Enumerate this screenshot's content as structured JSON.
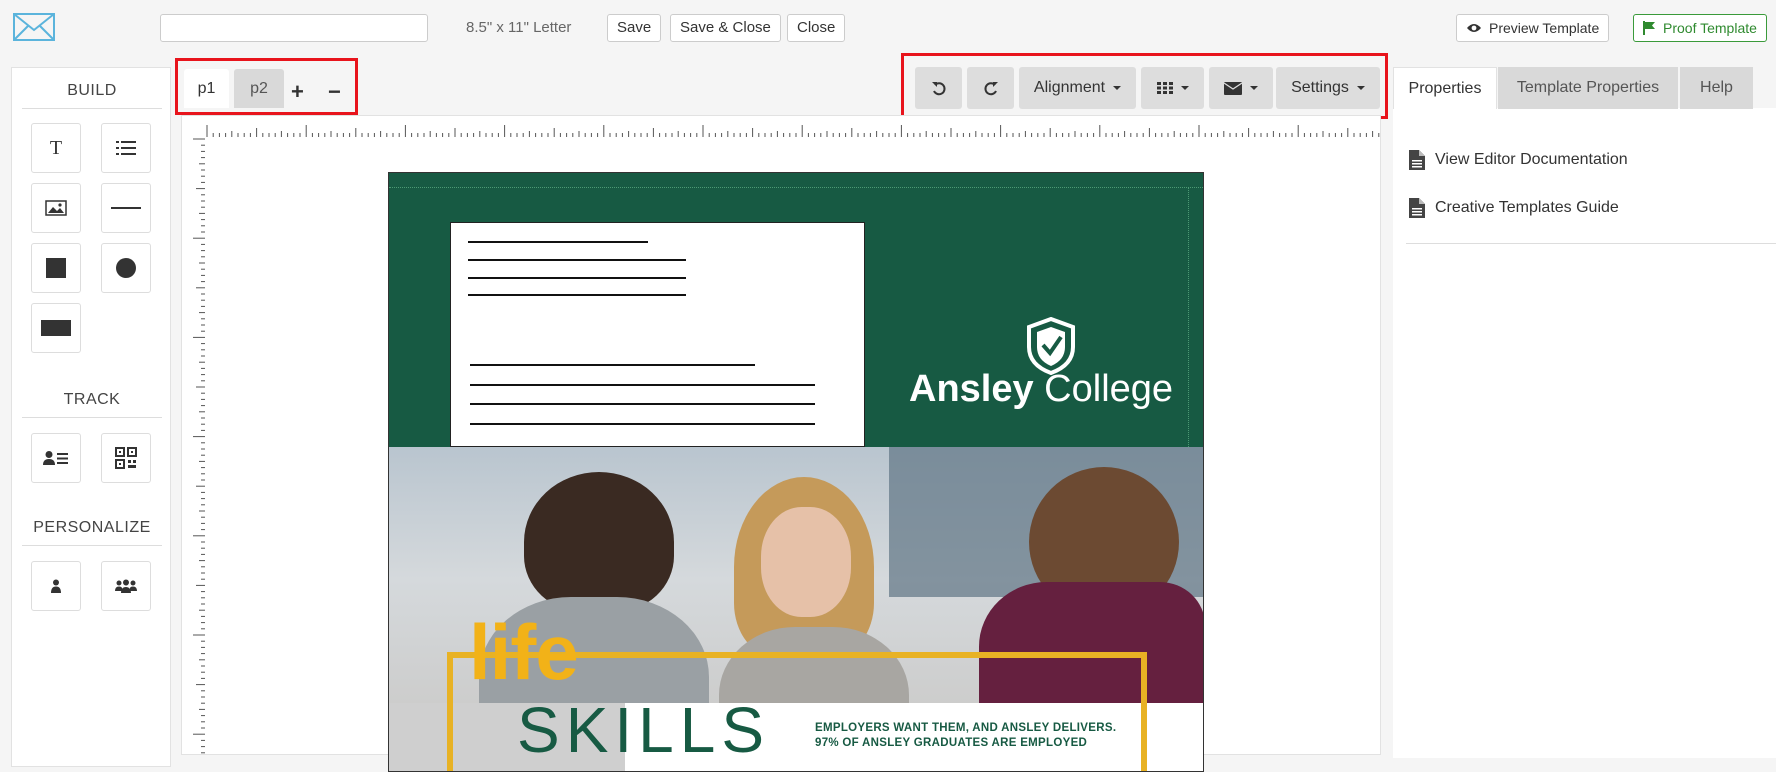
{
  "topbar": {
    "template_name_value": "",
    "page_size": "8.5\" x 11\" Letter",
    "save_label": "Save",
    "save_close_label": "Save & Close",
    "close_label": "Close",
    "preview_label": "Preview Template",
    "proof_label": "Proof Template"
  },
  "build_panel": {
    "build_title": "BUILD",
    "track_title": "TRACK",
    "personalize_title": "PERSONALIZE",
    "build_tools": [
      "text-tool",
      "list-tool",
      "image-tool",
      "line-tool",
      "rectangle-tool",
      "circle-tool",
      "wide-rectangle-tool"
    ],
    "track_tools": [
      "contact-field-tool",
      "qr-code-tool"
    ],
    "personalize_tools": [
      "single-person-tool",
      "group-tool"
    ]
  },
  "pages": {
    "tabs": [
      "p1",
      "p2"
    ],
    "active": "p1",
    "add_symbol": "+",
    "remove_symbol": "−"
  },
  "toolbar": {
    "undo_icon": "undo-icon",
    "redo_icon": "redo-icon",
    "alignment_label": "Alignment",
    "grid_icon": "grid-icon",
    "mail_icon": "envelope-icon",
    "settings_label": "Settings"
  },
  "document": {
    "college_bold": "Ansley",
    "college_light": " College",
    "life_text": "life",
    "skills_text": "SKILLS",
    "tagline_line1": "EMPLOYERS WANT THEM, AND ANSLEY DELIVERS.",
    "tagline_line2": "97% OF ANSLEY GRADUATES ARE EMPLOYED",
    "green_color": "#175a43",
    "gold_color": "#e8b224"
  },
  "right_panel": {
    "tabs": [
      "Properties",
      "Template Properties",
      "Help"
    ],
    "active_tab": "Properties",
    "links": [
      "View Editor Documentation",
      "Creative Templates Guide"
    ]
  },
  "colors": {
    "highlight_red": "#e8141c",
    "proof_green": "#2f8a2f",
    "logo_blue": "#5bb4dc"
  }
}
